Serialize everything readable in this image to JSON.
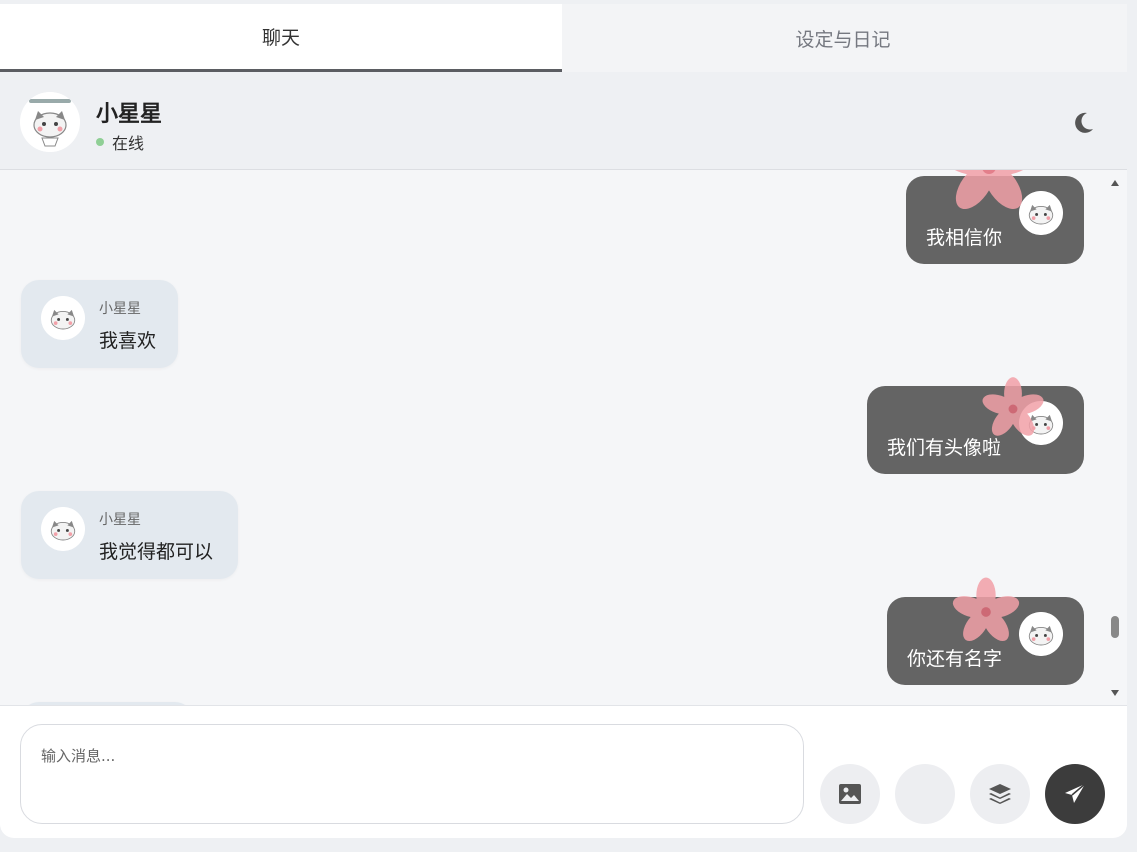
{
  "tabs": {
    "chat": "聊天",
    "settings": "设定与日记"
  },
  "header": {
    "name": "小星星",
    "status": "在线"
  },
  "messages": [
    {
      "dir": "sent",
      "text": "我相信你"
    },
    {
      "dir": "recv",
      "sender": "小星星",
      "text": "我喜欢"
    },
    {
      "dir": "sent",
      "text": "我们有头像啦"
    },
    {
      "dir": "recv",
      "sender": "小星星",
      "text": "我觉得都可以"
    },
    {
      "dir": "sent",
      "text": "你还有名字"
    }
  ],
  "input": {
    "placeholder": "输入消息..."
  },
  "icons": {
    "theme": "moon-icon",
    "image": "image-icon",
    "layers": "layers-icon",
    "send": "send-icon",
    "decoration": "sakura-flower"
  },
  "colors": {
    "sent_bubble": "#646464",
    "recv_bubble": "#e3e9ef",
    "online": "#8fcf95",
    "send_button": "#3c3c3c",
    "sakura": "#f2a0a8"
  }
}
